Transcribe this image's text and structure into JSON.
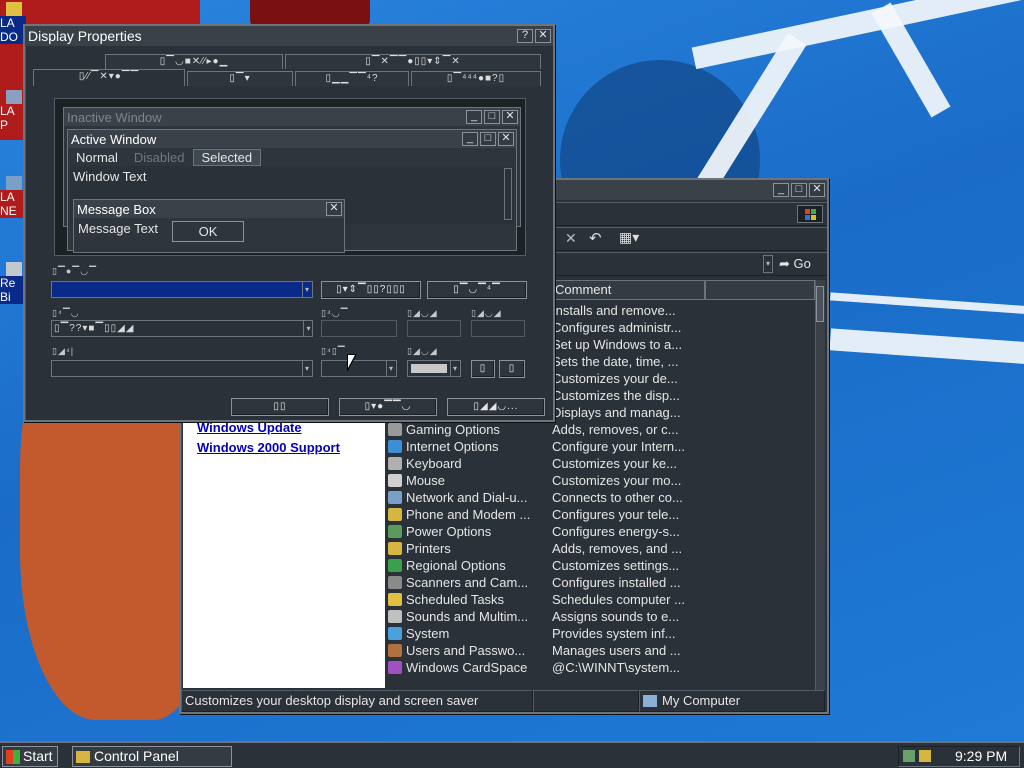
{
  "desktop": {
    "icons": [
      {
        "icon": "folder-icon",
        "lines": [
          "LA",
          "DO"
        ]
      },
      {
        "icon": "computer-icon",
        "lines": [
          "LA",
          "P"
        ]
      },
      {
        "icon": "network-icon",
        "lines": [
          "LA",
          "NE"
        ]
      },
      {
        "icon": "recycle-bin-icon",
        "lines": [
          "Re",
          "Bi"
        ]
      }
    ]
  },
  "control_panel": {
    "toolbar_go": "Go",
    "column_comment": "Comment",
    "links": [
      "Windows Update",
      "Windows 2000 Support"
    ],
    "items": [
      {
        "name": "",
        "comment": "Installs and remove...",
        "icon_color": "#c8c8c8"
      },
      {
        "name": "",
        "comment": "Configures administr...",
        "icon_color": "#c8c8c8"
      },
      {
        "name": "",
        "comment": "Set up Windows to a...",
        "icon_color": "#c8c8c8"
      },
      {
        "name": "",
        "comment": "Sets the date, time, ...",
        "icon_color": "#c8c8c8"
      },
      {
        "name": "",
        "comment": "Customizes your de...",
        "icon_color": "#c8c8c8"
      },
      {
        "name": "",
        "comment": "Customizes the disp...",
        "icon_color": "#c8c8c8"
      },
      {
        "name": "",
        "comment": "Displays and manag...",
        "icon_color": "#c8c8c8"
      },
      {
        "name": "Gaming Options",
        "comment": "Adds, removes, or c...",
        "icon_color": "#9a9a9a"
      },
      {
        "name": "Internet Options",
        "comment": "Configure your Intern...",
        "icon_color": "#3c8fd6"
      },
      {
        "name": "Keyboard",
        "comment": "Customizes your ke...",
        "icon_color": "#b0b0b0"
      },
      {
        "name": "Mouse",
        "comment": "Customizes your mo...",
        "icon_color": "#d0d0d0"
      },
      {
        "name": "Network and Dial-u...",
        "comment": "Connects to other co...",
        "icon_color": "#7aa0c8"
      },
      {
        "name": "Phone and Modem ...",
        "comment": "Configures your tele...",
        "icon_color": "#d4b640"
      },
      {
        "name": "Power Options",
        "comment": "Configures energy-s...",
        "icon_color": "#5a9a5a"
      },
      {
        "name": "Printers",
        "comment": "Adds, removes, and ...",
        "icon_color": "#d4b640"
      },
      {
        "name": "Regional Options",
        "comment": "Customizes settings...",
        "icon_color": "#3aa04a"
      },
      {
        "name": "Scanners and Cam...",
        "comment": "Configures installed ...",
        "icon_color": "#8a8a8a"
      },
      {
        "name": "Scheduled Tasks",
        "comment": "Schedules computer ...",
        "icon_color": "#e0c040"
      },
      {
        "name": "Sounds and Multim...",
        "comment": "Assigns sounds to e...",
        "icon_color": "#c0c0c0"
      },
      {
        "name": "System",
        "comment": "Provides system inf...",
        "icon_color": "#4aa0d8"
      },
      {
        "name": "Users and Passwo...",
        "comment": "Manages users and ...",
        "icon_color": "#b07040"
      },
      {
        "name": "Windows CardSpace",
        "comment": "@C:\\WINNT\\system...",
        "icon_color": "#a050c0"
      }
    ],
    "status_text": "Customizes your desktop display and screen saver",
    "status_zone": "My Computer"
  },
  "display_properties": {
    "title": "Display Properties",
    "tabs_row1": [
      "▯▔◡■✕⁄⁄▸●▁",
      "▯▔✕▔▔●▯▯▾⇕▔✕"
    ],
    "tabs_row2": [
      "▯⁄⁄▔✕▾●▔▔",
      "▯▔▾",
      "▯▁▁▔▔⁴?",
      "▯▔⁴⁴⁴●■?▯"
    ],
    "preview": {
      "inactive_title": "Inactive Window",
      "active_title": "Active Window",
      "menu_normal": "Normal",
      "menu_disabled": "Disabled",
      "menu_selected": "Selected",
      "window_text": "Window Text",
      "msgbox_title": "Message Box",
      "msgbox_text": "Message Text",
      "msgbox_ok": "OK"
    },
    "labels": {
      "scheme": "▯▔●▔◡▔",
      "item": "▯⁴▔◡",
      "font": "▯◢⁴|",
      "size1": "▯⁴◡▔",
      "color1": "▯◢◡◢",
      "color2": "▯◢◡◢",
      "size2": "▯⁴▯▔",
      "color3": "▯◢◡◢"
    },
    "buttons": {
      "save_as": "▯▾⇕▔▯▯?▯▯▯",
      "delete": "▯▔◡▔⁴▔",
      "ok": "▯▯",
      "cancel": "▯▾●▔▔◡",
      "apply": "▯◢◢◡..."
    },
    "item_value": "▯▔??▾■▔▯▯◢◢",
    "bold": "▯",
    "italic": "▯"
  },
  "taskbar": {
    "start": "Start",
    "task": "Control Panel",
    "clock": "9:29 PM"
  },
  "colors": {
    "selection_blue": "#0a2a8a",
    "window_bg": "#2b3138",
    "link_blue": "#0000c0"
  }
}
